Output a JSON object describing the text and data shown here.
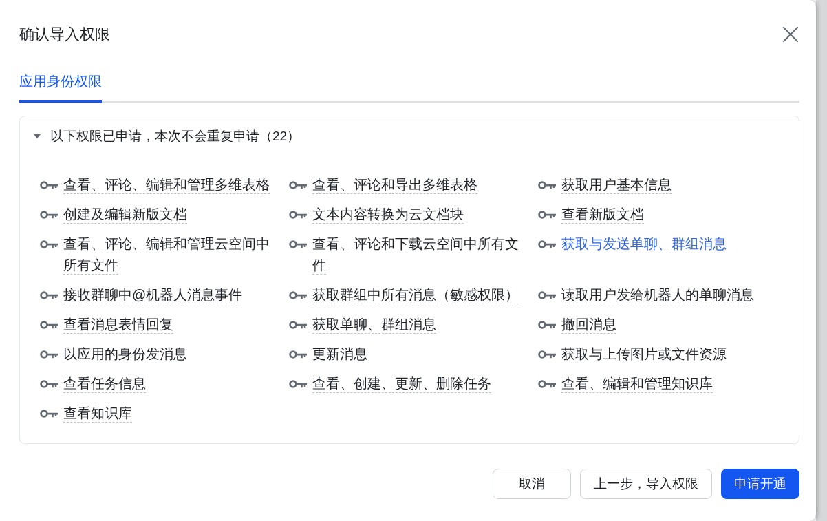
{
  "dialog": {
    "title": "确认导入权限"
  },
  "tabs": [
    {
      "label": "应用身份权限",
      "selected": true
    }
  ],
  "permission_group": {
    "title": "以下权限已申请，本次不会重复申请（22）",
    "expanded": true,
    "items": [
      {
        "label": "查看、评论、编辑和管理多维表格",
        "highlighted": false
      },
      {
        "label": "查看、评论和导出多维表格",
        "highlighted": false
      },
      {
        "label": "获取用户基本信息",
        "highlighted": false
      },
      {
        "label": "创建及编辑新版文档",
        "highlighted": false
      },
      {
        "label": "文本内容转换为云文档块",
        "highlighted": false
      },
      {
        "label": "查看新版文档",
        "highlighted": false
      },
      {
        "label": "查看、评论、编辑和管理云空间中所有文件",
        "highlighted": false
      },
      {
        "label": "查看、评论和下载云空间中所有文件",
        "highlighted": false
      },
      {
        "label": "获取与发送单聊、群组消息",
        "highlighted": true
      },
      {
        "label": "接收群聊中@机器人消息事件",
        "highlighted": false
      },
      {
        "label": "获取群组中所有消息（敏感权限）",
        "highlighted": false
      },
      {
        "label": "读取用户发给机器人的单聊消息",
        "highlighted": false
      },
      {
        "label": "查看消息表情回复",
        "highlighted": false
      },
      {
        "label": "获取单聊、群组消息",
        "highlighted": false
      },
      {
        "label": "撤回消息",
        "highlighted": false
      },
      {
        "label": "以应用的身份发消息",
        "highlighted": false
      },
      {
        "label": "更新消息",
        "highlighted": false
      },
      {
        "label": "获取与上传图片或文件资源",
        "highlighted": false
      },
      {
        "label": "查看任务信息",
        "highlighted": false
      },
      {
        "label": "查看、创建、更新、删除任务",
        "highlighted": false
      },
      {
        "label": "查看、编辑和管理知识库",
        "highlighted": false
      },
      {
        "label": "查看知识库",
        "highlighted": false
      }
    ]
  },
  "buttons": [
    {
      "label": "取消",
      "kind": "secondary"
    },
    {
      "label": "上一步，导入权限",
      "kind": "secondary"
    },
    {
      "label": "申请开通",
      "kind": "primary"
    }
  ]
}
